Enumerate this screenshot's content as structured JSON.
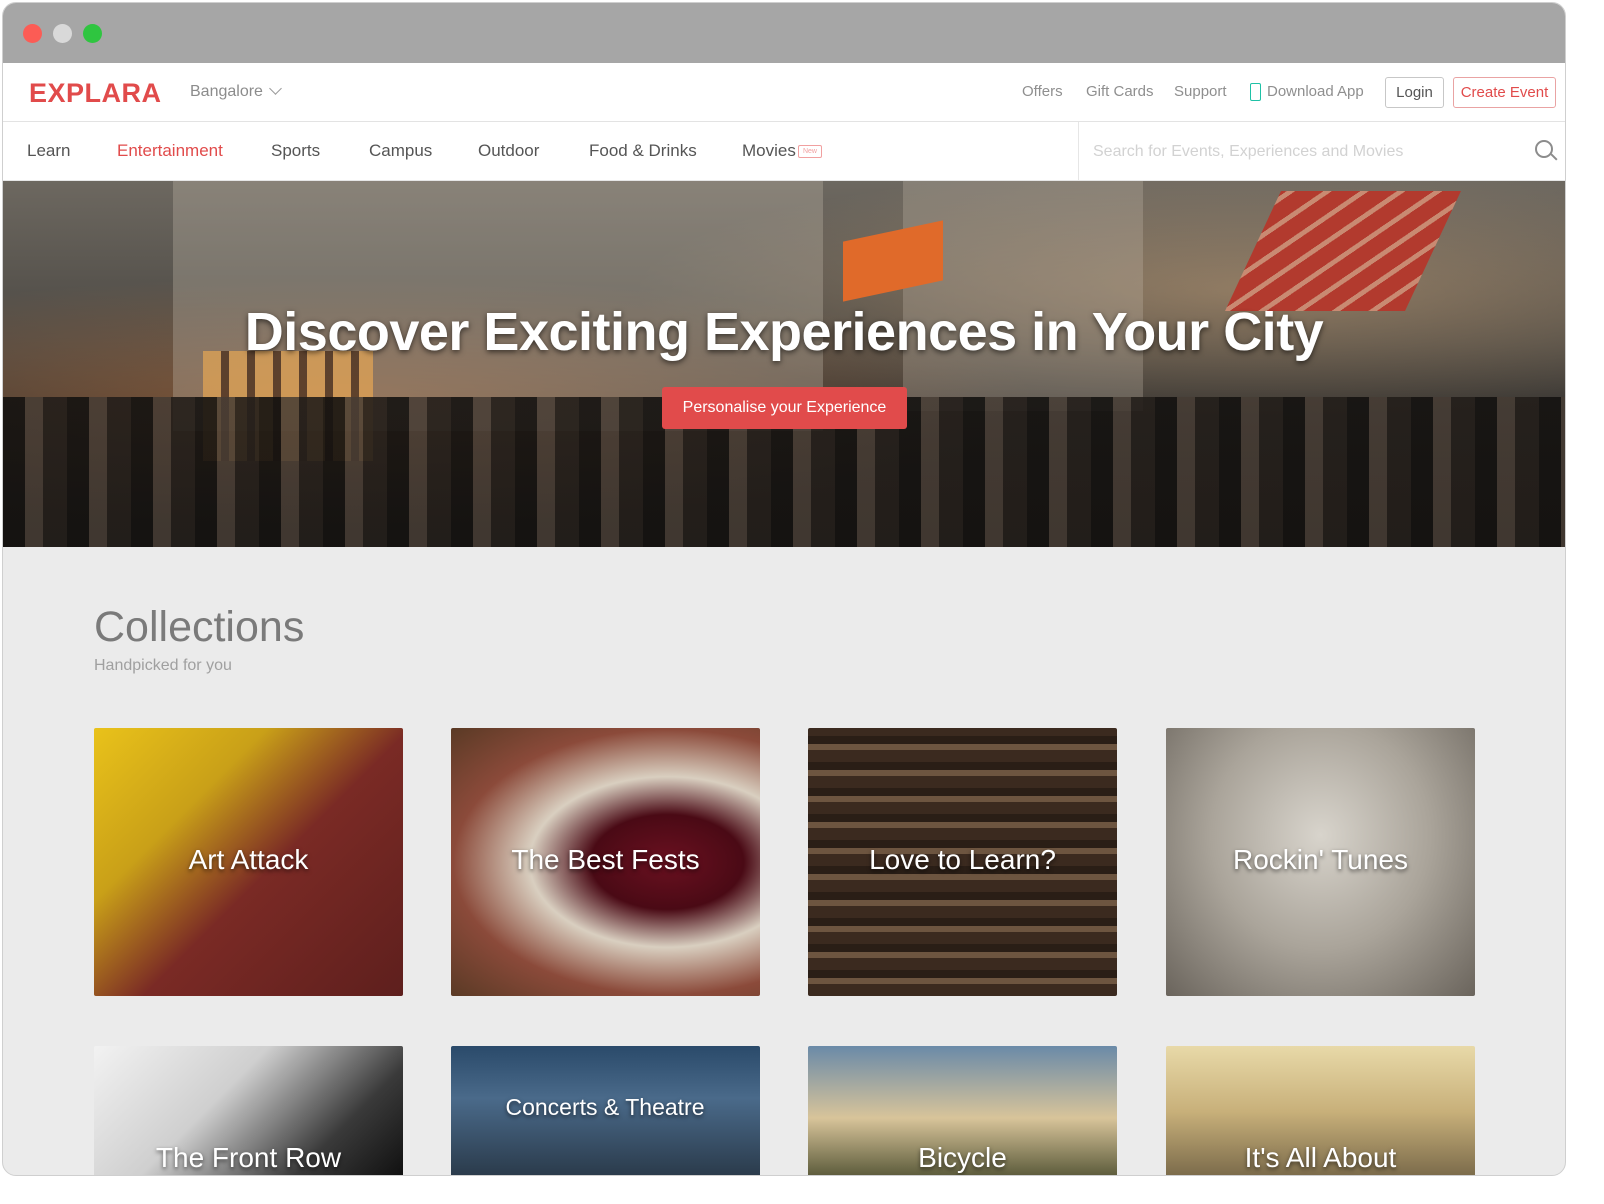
{
  "brand": {
    "logo": "EXPLARA",
    "accent": "#e14b4b"
  },
  "header": {
    "city": "Bangalore",
    "links": [
      "Offers",
      "Gift Cards",
      "Support",
      "Download App"
    ],
    "login_label": "Login",
    "create_event_label": "Create Event"
  },
  "nav": {
    "items": [
      "Learn",
      "Entertainment",
      "Sports",
      "Campus",
      "Outdoor",
      "Food & Drinks",
      "Movies"
    ],
    "active": "Entertainment",
    "new_badge": "New",
    "search_placeholder": "Search for Events, Experiences and Movies"
  },
  "hero": {
    "title": "Discover Exciting Experiences in Your City",
    "button_label": "Personalise your Experience"
  },
  "collections": {
    "title": "Collections",
    "subtitle": "Handpicked for you",
    "items": [
      {
        "label": "Art Attack"
      },
      {
        "label": "The Best Fests"
      },
      {
        "label": "Love to Learn?"
      },
      {
        "label": "Rockin' Tunes"
      },
      {
        "label": "The Front Row"
      },
      {
        "label": "Concerts & Theatre"
      },
      {
        "label": "Bicycle"
      },
      {
        "label": "It's All About"
      }
    ]
  }
}
